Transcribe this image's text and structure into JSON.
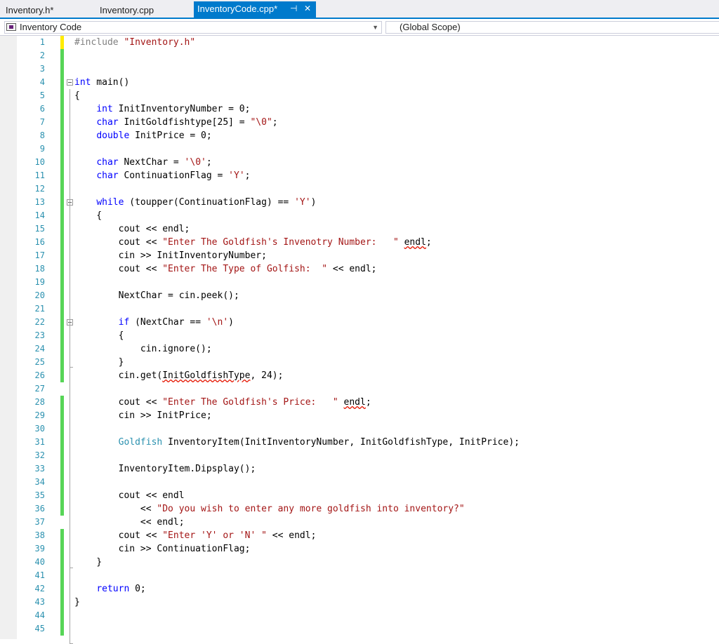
{
  "tabs": [
    {
      "label": "Inventory.h*"
    },
    {
      "label": "Inventory.cpp"
    },
    {
      "label": "InventoryCode.cpp*",
      "pin": "⊣",
      "close": "✕"
    }
  ],
  "nav": {
    "project": "Inventory Code",
    "scope": "(Global Scope)"
  },
  "colors": {
    "accent": "#007acc",
    "keyword": "#0000ff",
    "string": "#a31515",
    "type": "#2b91af",
    "saved_change": "#57d557",
    "unsaved_change": "#ffec00"
  },
  "code_lines": [
    [
      {
        "t": "#include ",
        "c": "p"
      },
      {
        "t": "\"Inventory.h\"",
        "c": "s"
      }
    ],
    [],
    [],
    [
      {
        "t": "int",
        "c": "k"
      },
      {
        "t": " main()"
      }
    ],
    [
      {
        "t": "{"
      }
    ],
    [
      {
        "t": "    "
      },
      {
        "t": "int",
        "c": "k"
      },
      {
        "t": " InitInventoryNumber = 0;"
      }
    ],
    [
      {
        "t": "    "
      },
      {
        "t": "char",
        "c": "k"
      },
      {
        "t": " InitGoldfishtype[25] = "
      },
      {
        "t": "\"\\0\"",
        "c": "s"
      },
      {
        "t": ";"
      }
    ],
    [
      {
        "t": "    "
      },
      {
        "t": "double",
        "c": "k"
      },
      {
        "t": " InitPrice = 0;"
      }
    ],
    [],
    [
      {
        "t": "    "
      },
      {
        "t": "char",
        "c": "k"
      },
      {
        "t": " NextChar = "
      },
      {
        "t": "'\\0'",
        "c": "s"
      },
      {
        "t": ";"
      }
    ],
    [
      {
        "t": "    "
      },
      {
        "t": "char",
        "c": "k"
      },
      {
        "t": " ContinuationFlag = "
      },
      {
        "t": "'Y'",
        "c": "s"
      },
      {
        "t": ";"
      }
    ],
    [],
    [
      {
        "t": "    "
      },
      {
        "t": "while",
        "c": "k"
      },
      {
        "t": " (toupper(ContinuationFlag) == "
      },
      {
        "t": "'Y'",
        "c": "s"
      },
      {
        "t": ")"
      }
    ],
    [
      {
        "t": "    {"
      }
    ],
    [
      {
        "t": "        cout << endl;"
      }
    ],
    [
      {
        "t": "        cout << "
      },
      {
        "t": "\"Enter The Goldfish's Invenotry Number:   \"",
        "c": "s"
      },
      {
        "t": " "
      },
      {
        "t": "endl",
        "c": "sq"
      },
      {
        "t": ";"
      }
    ],
    [
      {
        "t": "        cin >> InitInventoryNumber;"
      }
    ],
    [
      {
        "t": "        cout << "
      },
      {
        "t": "\"Enter The Type of Golfish:  \"",
        "c": "s"
      },
      {
        "t": " << endl;"
      }
    ],
    [],
    [
      {
        "t": "        NextChar = cin.peek();"
      }
    ],
    [],
    [
      {
        "t": "        "
      },
      {
        "t": "if",
        "c": "k"
      },
      {
        "t": " (NextChar == "
      },
      {
        "t": "'\\n'",
        "c": "s"
      },
      {
        "t": ")"
      }
    ],
    [
      {
        "t": "        {"
      }
    ],
    [
      {
        "t": "            cin.ignore();"
      }
    ],
    [
      {
        "t": "        }"
      }
    ],
    [
      {
        "t": "        cin.get("
      },
      {
        "t": "InitGoldfishType",
        "c": "sq"
      },
      {
        "t": ", 24);"
      }
    ],
    [],
    [
      {
        "t": "        cout << "
      },
      {
        "t": "\"Enter The Goldfish's Price:   \"",
        "c": "s"
      },
      {
        "t": " "
      },
      {
        "t": "endl",
        "c": "sq"
      },
      {
        "t": ";"
      }
    ],
    [
      {
        "t": "        cin >> InitPrice;"
      }
    ],
    [],
    [
      {
        "t": "        "
      },
      {
        "t": "Goldfish",
        "c": "t"
      },
      {
        "t": " InventoryItem(InitInventoryNumber, InitGoldfishType, InitPrice);"
      }
    ],
    [],
    [
      {
        "t": "        InventoryItem.Dipsplay();"
      }
    ],
    [],
    [
      {
        "t": "        cout << endl"
      }
    ],
    [
      {
        "t": "            << "
      },
      {
        "t": "\"Do you wish to enter any more goldfish into inventory?\"",
        "c": "s"
      }
    ],
    [
      {
        "t": "            << endl;"
      }
    ],
    [
      {
        "t": "        cout << "
      },
      {
        "t": "\"Enter 'Y' or 'N' \"",
        "c": "s"
      },
      {
        "t": " << endl;"
      }
    ],
    [
      {
        "t": "        cin >> ContinuationFlag;"
      }
    ],
    [
      {
        "t": "    }"
      }
    ],
    [],
    [
      {
        "t": "    "
      },
      {
        "t": "return",
        "c": "k"
      },
      {
        "t": " 0;"
      }
    ],
    [
      {
        "t": "}"
      }
    ],
    [],
    []
  ]
}
